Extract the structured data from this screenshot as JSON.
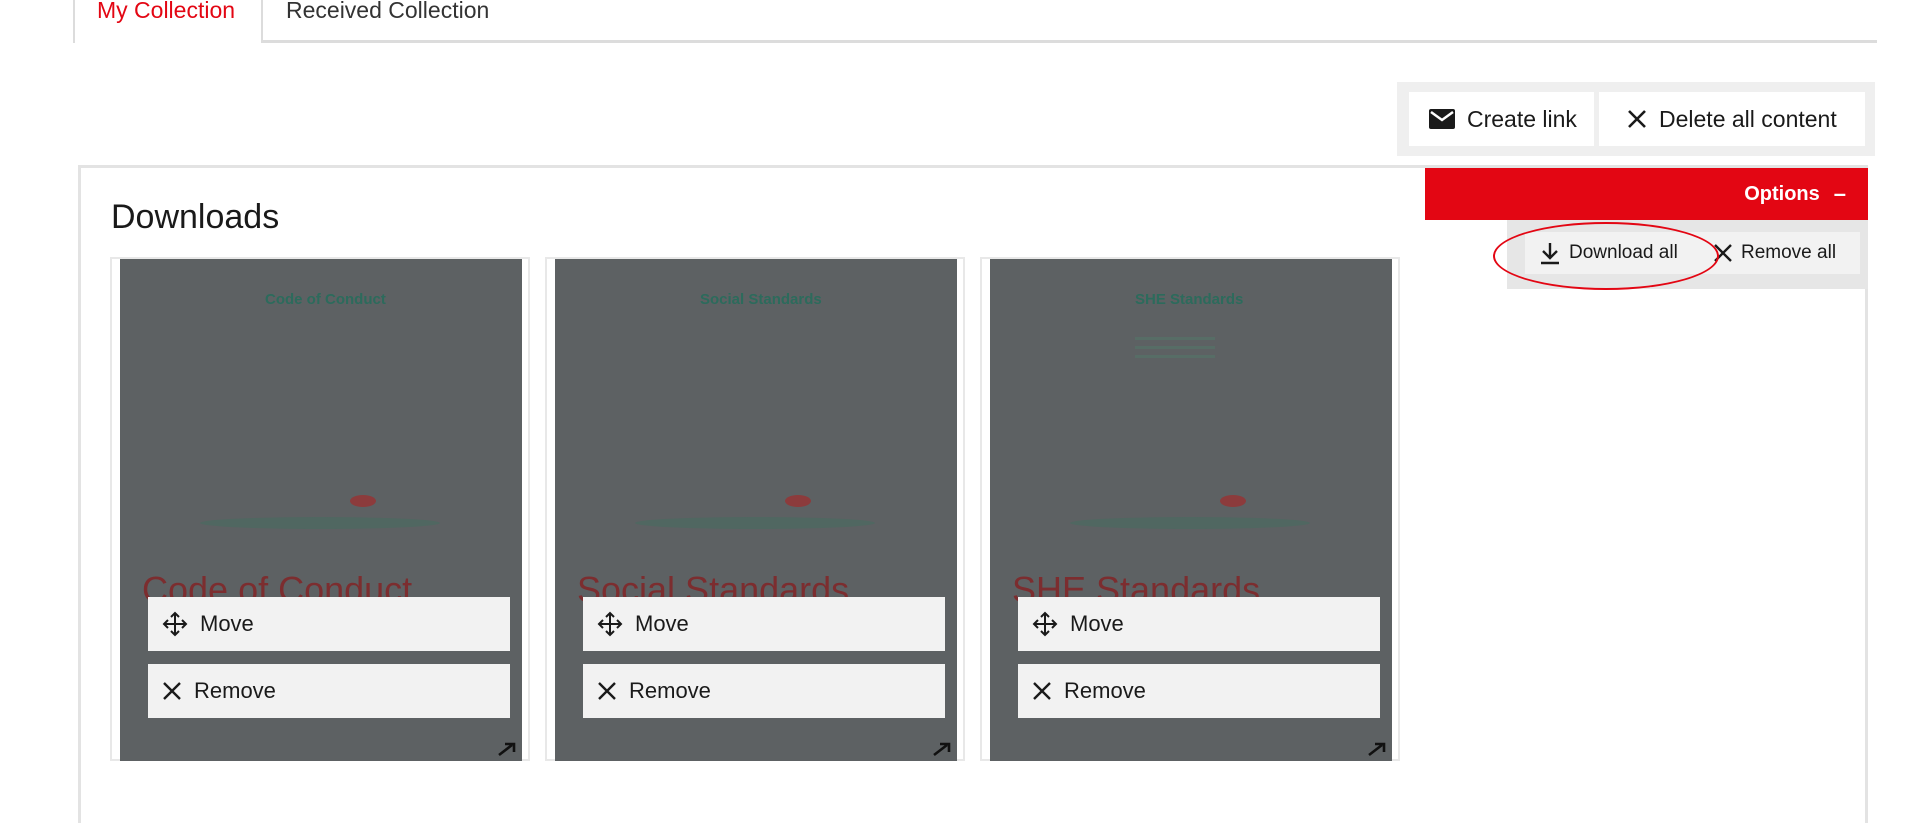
{
  "tabs": [
    {
      "label": "My Collection",
      "active": true
    },
    {
      "label": "Received Collection",
      "active": false
    }
  ],
  "toolbar": {
    "create_link": "Create link",
    "delete_all": "Delete all content"
  },
  "panel": {
    "title": "Downloads"
  },
  "options": {
    "label": "Options",
    "toggle": "–",
    "download_all": "Download all",
    "remove_all": "Remove all"
  },
  "cards": [
    {
      "cover_title": "Code of Conduct",
      "name": "Code of Conduct",
      "move": "Move",
      "remove": "Remove"
    },
    {
      "cover_title": "Social Standards",
      "name": "Social Standards",
      "move": "Move",
      "remove": "Remove"
    },
    {
      "cover_title": "SHE Standards",
      "name": "SHE Standards",
      "move": "Move",
      "remove": "Remove"
    }
  ],
  "icons": {
    "create_link": "envelope-icon",
    "delete_all": "close-icon",
    "download_all": "download-icon",
    "remove_all": "close-icon",
    "move": "move-icon",
    "remove": "close-icon",
    "expand": "expand-arrow-icon"
  },
  "colors": {
    "accent": "#e30613",
    "overlay": "#5d6163",
    "button_bg": "#f2f2f2"
  }
}
